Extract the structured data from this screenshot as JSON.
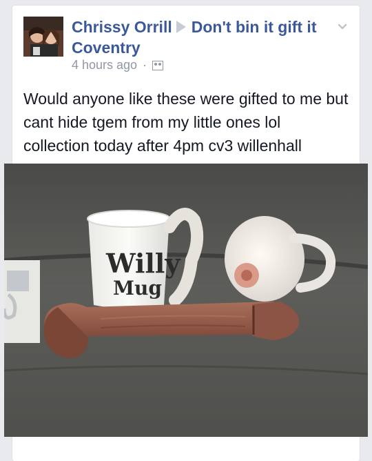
{
  "post": {
    "author_name": "Chrissy Orrill",
    "group_name_line1": "Don't bin it gift it",
    "group_name_line2": "Coventry",
    "timestamp": "4 hours ago",
    "meta_separator": "·",
    "audience_icon": "group-audience-icon",
    "options_icon": "chevron-down-icon",
    "message": "Would anyone like these were gifted to me but cant hide tgem from my little ones lol collection today after 4pm cv3 willenhall"
  },
  "photo": {
    "mug_text_line1": "Willy",
    "mug_text_line2": "Mug"
  },
  "colors": {
    "link": "#3b5998",
    "meta": "#9197a3",
    "text": "#141823",
    "background": "#e9eaee"
  }
}
